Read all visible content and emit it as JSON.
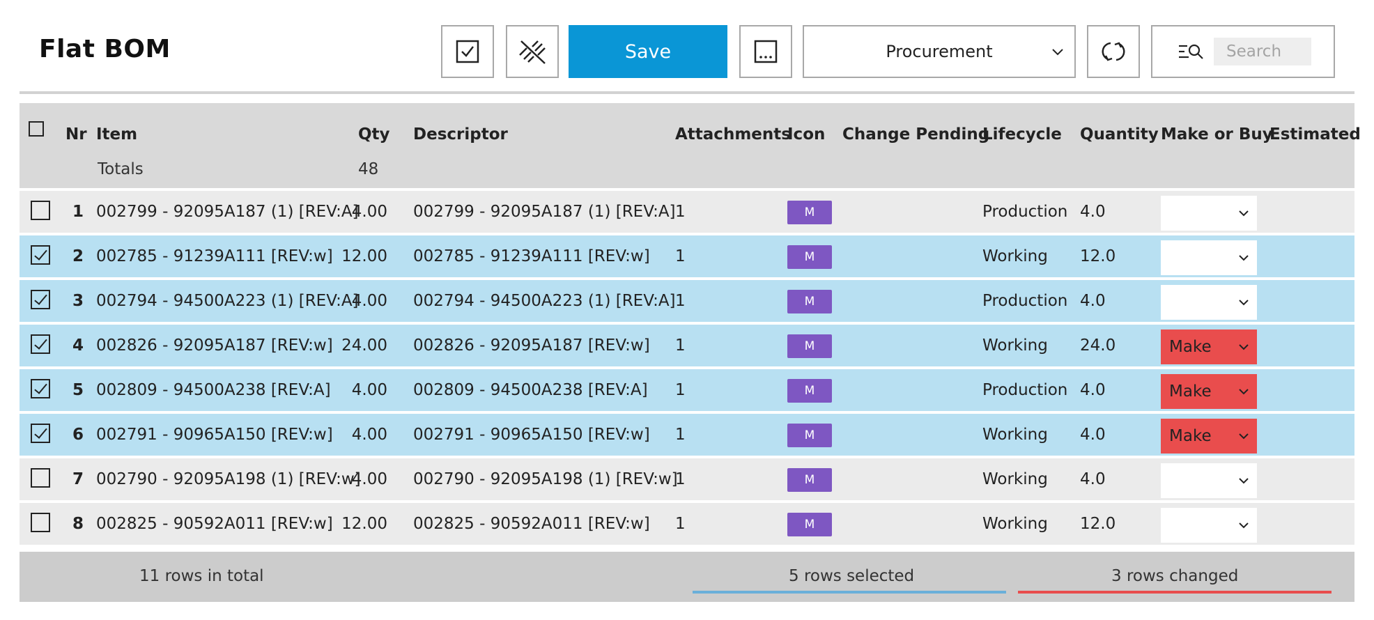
{
  "page": {
    "title": "Flat BOM"
  },
  "toolbar": {
    "save_label": "Save",
    "more_label": "...",
    "view_select": {
      "value": "Procurement",
      "icon": "chevron-down-icon"
    },
    "search": {
      "placeholder": "Search",
      "value": ""
    },
    "icons": [
      "checkbox-icon",
      "disconnect-icon",
      "more-icon",
      "refresh-icon",
      "search-filter-icon"
    ]
  },
  "table": {
    "columns": [
      "Nr",
      "Item",
      "Qty",
      "Descriptor",
      "Attachments",
      "Icon",
      "Change Pending",
      "Lifecycle",
      "Quantity",
      "Make or Buy",
      "Estimated"
    ],
    "totals": {
      "label": "Totals",
      "qty": "48"
    },
    "rows": [
      {
        "selected": false,
        "nr": "1",
        "item": "002799 - 92095A187 (1) [REV:A]",
        "qty": "4.00",
        "descriptor": "002799 - 92095A187 (1) [REV:A]",
        "attachments": "1",
        "icon": "M",
        "change_pending": "",
        "lifecycle": "Production",
        "quantity": "4.0",
        "make_or_buy": "",
        "estimated": ""
      },
      {
        "selected": true,
        "nr": "2",
        "item": "002785 - 91239A111 [REV:w]",
        "qty": "12.00",
        "descriptor": "002785 - 91239A111 [REV:w]",
        "attachments": "1",
        "icon": "M",
        "change_pending": "",
        "lifecycle": "Working",
        "quantity": "12.0",
        "make_or_buy": "",
        "estimated": ""
      },
      {
        "selected": true,
        "nr": "3",
        "item": "002794 - 94500A223 (1) [REV:A]",
        "qty": "4.00",
        "descriptor": "002794 - 94500A223 (1) [REV:A]",
        "attachments": "1",
        "icon": "M",
        "change_pending": "",
        "lifecycle": "Production",
        "quantity": "4.0",
        "make_or_buy": "",
        "estimated": ""
      },
      {
        "selected": true,
        "nr": "4",
        "item": "002826 - 92095A187 [REV:w]",
        "qty": "24.00",
        "descriptor": "002826 - 92095A187 [REV:w]",
        "attachments": "1",
        "icon": "M",
        "change_pending": "",
        "lifecycle": "Working",
        "quantity": "24.0",
        "make_or_buy": "Make",
        "estimated": ""
      },
      {
        "selected": true,
        "nr": "5",
        "item": "002809 - 94500A238 [REV:A]",
        "qty": "4.00",
        "descriptor": "002809 - 94500A238 [REV:A]",
        "attachments": "1",
        "icon": "M",
        "change_pending": "",
        "lifecycle": "Production",
        "quantity": "4.0",
        "make_or_buy": "Make",
        "estimated": ""
      },
      {
        "selected": true,
        "nr": "6",
        "item": "002791 - 90965A150 [REV:w]",
        "qty": "4.00",
        "descriptor": "002791 - 90965A150 [REV:w]",
        "attachments": "1",
        "icon": "M",
        "change_pending": "",
        "lifecycle": "Working",
        "quantity": "4.0",
        "make_or_buy": "Make",
        "estimated": ""
      },
      {
        "selected": false,
        "nr": "7",
        "item": "002790 - 92095A198 (1) [REV:w]",
        "qty": "4.00",
        "descriptor": "002790 - 92095A198 (1) [REV:w]",
        "attachments": "1",
        "icon": "M",
        "change_pending": "",
        "lifecycle": "Working",
        "quantity": "4.0",
        "make_or_buy": "",
        "estimated": ""
      },
      {
        "selected": false,
        "nr": "8",
        "item": "002825 - 90592A011 [REV:w]",
        "qty": "12.00",
        "descriptor": "002825 - 90592A011 [REV:w]",
        "attachments": "1",
        "icon": "M",
        "change_pending": "",
        "lifecycle": "Working",
        "quantity": "12.0",
        "make_or_buy": "",
        "estimated": ""
      }
    ]
  },
  "footer": {
    "total": "11 rows in total",
    "selected": "5 rows selected",
    "changed": "3 rows changed"
  },
  "colors": {
    "accent": "#0a96d6",
    "selected_row": "#b8e0f2",
    "normal_row": "#ebebeb",
    "badge": "#7e57c2",
    "changed": "#e94d4d",
    "selected_line": "#6aafd9"
  }
}
